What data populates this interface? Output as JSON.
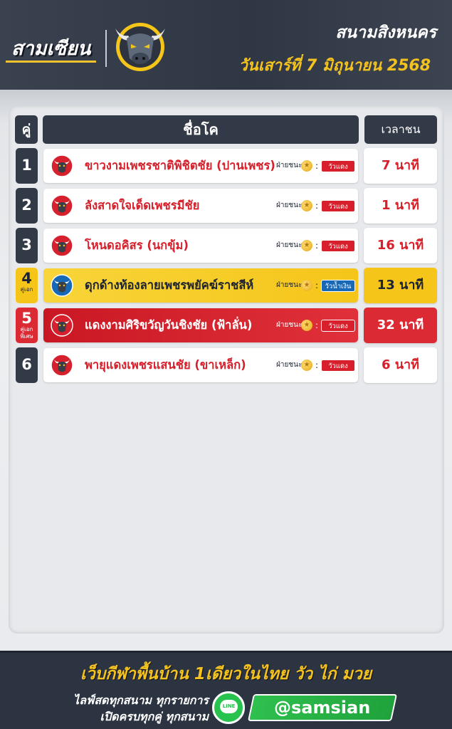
{
  "header": {
    "brand": "สามเซียน",
    "venue": "สนามสิงหนคร",
    "date": "วันเสาร์ที่ 7 มิถุนายน 2568"
  },
  "table": {
    "col_no": "คู่",
    "col_name": "ชื่อโค",
    "col_time": "เวลาชน",
    "win_label": "ฝ่ายชนะ",
    "rows": [
      {
        "no": "1",
        "tag": "",
        "name": "ขาวงามเพชรชาติพิชิตชัย (ปานเพชร)",
        "corner": "วัวแดง",
        "time": "7 นาที",
        "style": "normal"
      },
      {
        "no": "2",
        "tag": "",
        "name": "ลังสาดใจเด็ดเพชรมีชัย",
        "corner": "วัวแดง",
        "time": "1 นาที",
        "style": "normal"
      },
      {
        "no": "3",
        "tag": "",
        "name": "โหนดอคิสร (นกขุ้ม)",
        "corner": "วัวแดง",
        "time": "16 นาที",
        "style": "normal"
      },
      {
        "no": "4",
        "tag": "คู่เอก",
        "name": "ดุกด้างท้องลายเพชรพยัคฆ์ราชสีห์",
        "corner": "วัวน้ำเงิน",
        "time": "13 นาที",
        "style": "major"
      },
      {
        "no": "5",
        "tag": "คู่เอกพิเศษ",
        "name": "แดงงามศิริขวัญวันชิงชัย (ฟ้าลั่น)",
        "corner": "วัวแดง",
        "time": "32 นาที",
        "style": "sub"
      },
      {
        "no": "6",
        "tag": "",
        "name": "พายุแดงเพชรแสนชัย (ขาเหล็ก)",
        "corner": "วัวแดง",
        "time": "6 นาที",
        "style": "normal"
      }
    ]
  },
  "footer": {
    "tagline": "เว็บกีฬาพื้นบ้าน 1เดียวในไทย วัว ไก่ มวย",
    "live_line1": "ไลฟ์สดทุกสนาม ทุกรายการ",
    "live_line2": "เปิดครบทุกคู่ ทุกสนาม",
    "line_icon": "LINE",
    "handle": "@samsian"
  },
  "colors": {
    "dark": "#323a47",
    "gold": "#f5c519",
    "red": "#dc2a35",
    "blue": "#1769b8",
    "green": "#28c24e"
  }
}
